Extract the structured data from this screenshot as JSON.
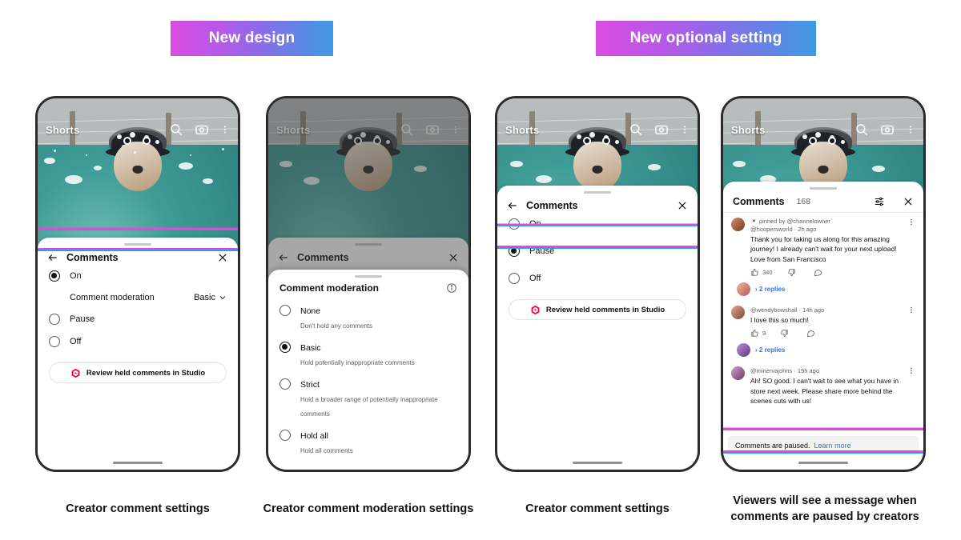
{
  "banners": {
    "new_design": "New design",
    "new_optional_setting": "New optional setting"
  },
  "shorts": {
    "title": "Shorts",
    "icons": [
      "search-icon",
      "camera-icon",
      "more-vertical-icon"
    ]
  },
  "comments_sheet": {
    "title": "Comments",
    "back_icon": "back-arrow-icon",
    "close_icon": "close-icon",
    "options": [
      {
        "label": "On"
      },
      {
        "label": "Pause"
      },
      {
        "label": "Off"
      }
    ],
    "moderation_row": {
      "label": "Comment moderation",
      "value": "Basic",
      "chevron": "chevron-down-icon"
    },
    "studio_button": {
      "label": "Review held comments in Studio",
      "icon": "youtube-studio-icon"
    }
  },
  "moderation_sheet": {
    "title": "Comment moderation",
    "info_icon": "info-icon",
    "options": [
      {
        "title": "None",
        "subtitle": "Don't hold any comments"
      },
      {
        "title": "Basic",
        "subtitle": "Hold potentially inappropriate comments"
      },
      {
        "title": "Strict",
        "subtitle": "Hold a broader range of potentially inappropriate comments"
      },
      {
        "title": "Hold all",
        "subtitle": "Hold all comments"
      }
    ]
  },
  "viewer_comments": {
    "title": "Comments",
    "count": "168",
    "filter_icon": "sort-filter-icon",
    "close_icon": "close-icon",
    "items": [
      {
        "pinned_label": "pinned by @channelowner",
        "meta": "@hoopersworld · 2h ago",
        "text": "Thank you for taking us along for this amazing journey! I already can't wait for your next upload! Love from San Francisco",
        "likes": "340",
        "replies": "2 replies"
      },
      {
        "pinned_label": "",
        "meta": "@wendybowshall · 14h ago",
        "text": "I love this so much!",
        "likes": "9",
        "replies": "2 replies"
      },
      {
        "pinned_label": "",
        "meta": "@minervajohns · 19h ago",
        "text": "Ah! SO good. I can't wait to see what you have in store next week. Please share more behind the scenes cuts with us!",
        "likes": "",
        "replies": ""
      }
    ],
    "paused_banner": {
      "text": "Comments are paused.",
      "link": "Learn more"
    }
  },
  "captions": {
    "phone1": "Creator comment settings",
    "phone2": "Creator comment moderation settings",
    "phone3": "Creator comment settings",
    "phone4": "Viewers will see a message when comments are paused by creators"
  },
  "colors": {
    "highlight_magenta": "#e24bd8",
    "highlight_blue": "#28a0f0",
    "link_blue": "#3b6fe0",
    "studio_red": "#ff0033"
  }
}
